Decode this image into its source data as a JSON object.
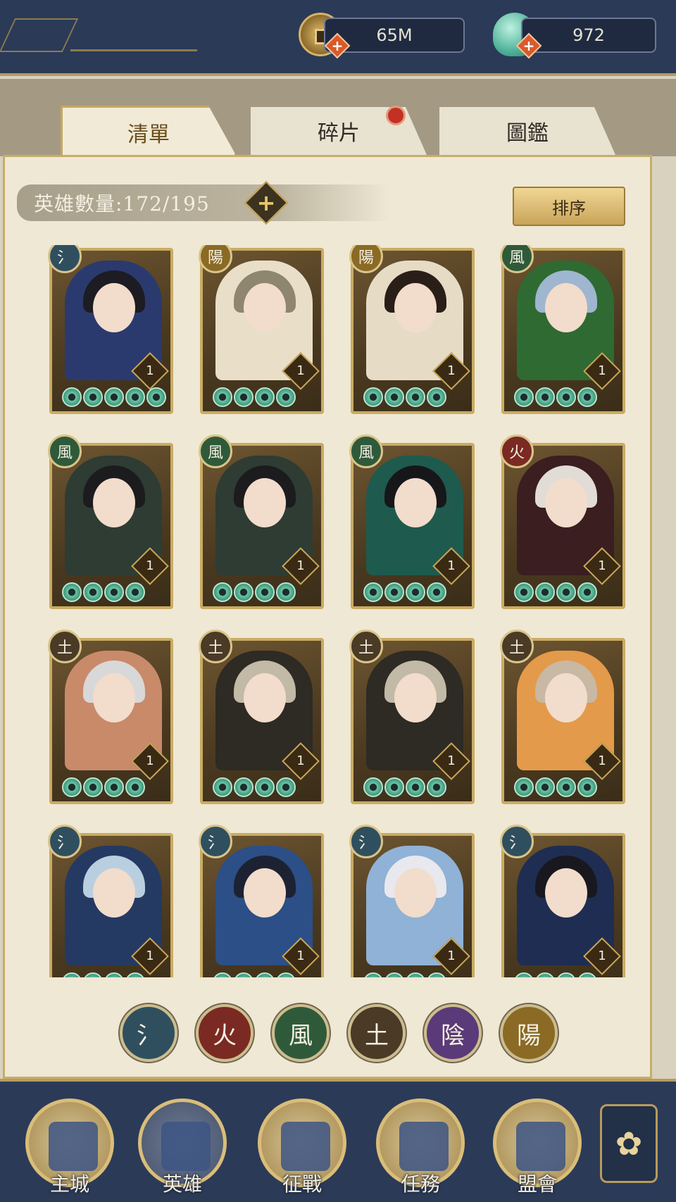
{
  "currency": {
    "coins": "65M",
    "jade": "972",
    "plus": "+"
  },
  "tabs": [
    {
      "label": "清單",
      "active": true
    },
    {
      "label": "碎片",
      "active": false,
      "badge": true
    },
    {
      "label": "圖鑑",
      "active": false
    }
  ],
  "hero_count": {
    "label": "英雄數量:172/195",
    "plus": "+"
  },
  "sort_label": "排序",
  "elements": {
    "water": {
      "glyph": "氵",
      "color": "#2f4f5f"
    },
    "fire": {
      "glyph": "火",
      "color": "#7a2a22"
    },
    "wind": {
      "glyph": "風",
      "color": "#2f5a3a"
    },
    "earth": {
      "glyph": "土",
      "color": "#4a3a26"
    },
    "yin": {
      "glyph": "陰",
      "color": "#5a3a78"
    },
    "yang": {
      "glyph": "陽",
      "color": "#8a6a24"
    }
  },
  "heroes": [
    {
      "element": "氵",
      "color": "#2f4f5f",
      "level": "1",
      "stars": 5,
      "outfit": "#2b3a6e",
      "hair": "#1c1c22"
    },
    {
      "element": "陽",
      "color": "#8a6a24",
      "level": "1",
      "stars": 4,
      "outfit": "#e9dfc8",
      "hair": "#8f8670"
    },
    {
      "element": "陽",
      "color": "#8a6a24",
      "level": "1",
      "stars": 4,
      "outfit": "#e6dcc6",
      "hair": "#2a1f18"
    },
    {
      "element": "風",
      "color": "#2f5a3a",
      "level": "1",
      "stars": 4,
      "outfit": "#2f6a32",
      "hair": "#9eb6cf"
    },
    {
      "element": "風",
      "color": "#2f5a3a",
      "level": "1",
      "stars": 4,
      "outfit": "#2e3c34",
      "hair": "#1c1c1e"
    },
    {
      "element": "風",
      "color": "#2f5a3a",
      "level": "1",
      "stars": 4,
      "outfit": "#2e3c34",
      "hair": "#1c1c1e"
    },
    {
      "element": "風",
      "color": "#2f5a3a",
      "level": "1",
      "stars": 4,
      "outfit": "#1f5a4e",
      "hair": "#17171a"
    },
    {
      "element": "火",
      "color": "#7a2a22",
      "level": "1",
      "stars": 4,
      "outfit": "#3a1e20",
      "hair": "#e2dcd6"
    },
    {
      "element": "土",
      "color": "#4a3a26",
      "level": "1",
      "stars": 4,
      "outfit": "#c98a6a",
      "hair": "#d8d8d8"
    },
    {
      "element": "土",
      "color": "#4a3a26",
      "level": "1",
      "stars": 4,
      "outfit": "#2e2a24",
      "hair": "#c2b9a6"
    },
    {
      "element": "土",
      "color": "#4a3a26",
      "level": "1",
      "stars": 4,
      "outfit": "#2e2a24",
      "hair": "#c2b9a6"
    },
    {
      "element": "土",
      "color": "#4a3a26",
      "level": "1",
      "stars": 4,
      "outfit": "#e39a4a",
      "hair": "#c8b8a4"
    },
    {
      "element": "氵",
      "color": "#2f4f5f",
      "level": "1",
      "stars": 4,
      "outfit": "#243a62",
      "hair": "#b9cfe0"
    },
    {
      "element": "氵",
      "color": "#2f4f5f",
      "level": "1",
      "stars": 4,
      "outfit": "#2b4f86",
      "hair": "#1d2233"
    },
    {
      "element": "氵",
      "color": "#2f4f5f",
      "level": "1",
      "stars": 4,
      "outfit": "#8fb2d6",
      "hair": "#e8e8ee"
    },
    {
      "element": "氵",
      "color": "#2f4f5f",
      "level": "1",
      "stars": 4,
      "outfit": "#1f2d52",
      "hair": "#18181e"
    }
  ],
  "filters": [
    {
      "name": "filter-water-button",
      "glyph": "氵",
      "color": "#2f4f5f"
    },
    {
      "name": "filter-fire-button",
      "glyph": "火",
      "color": "#7a2a22"
    },
    {
      "name": "filter-wind-button",
      "glyph": "風",
      "color": "#2f5a3a"
    },
    {
      "name": "filter-earth-button",
      "glyph": "土",
      "color": "#4a3a26"
    },
    {
      "name": "filter-yin-button",
      "glyph": "陰",
      "color": "#5a3a78"
    },
    {
      "name": "filter-yang-button",
      "glyph": "陽",
      "color": "#8a6a24"
    }
  ],
  "nav": [
    {
      "label": "主城",
      "icon": "castle-icon"
    },
    {
      "label": "英雄",
      "icon": "hero-avatar-icon",
      "active": true
    },
    {
      "label": "征戰",
      "icon": "scroll-icon"
    },
    {
      "label": "任務",
      "icon": "task-icon"
    },
    {
      "label": "盟會",
      "icon": "gate-icon"
    }
  ],
  "menu_icon": "flower-menu-icon"
}
